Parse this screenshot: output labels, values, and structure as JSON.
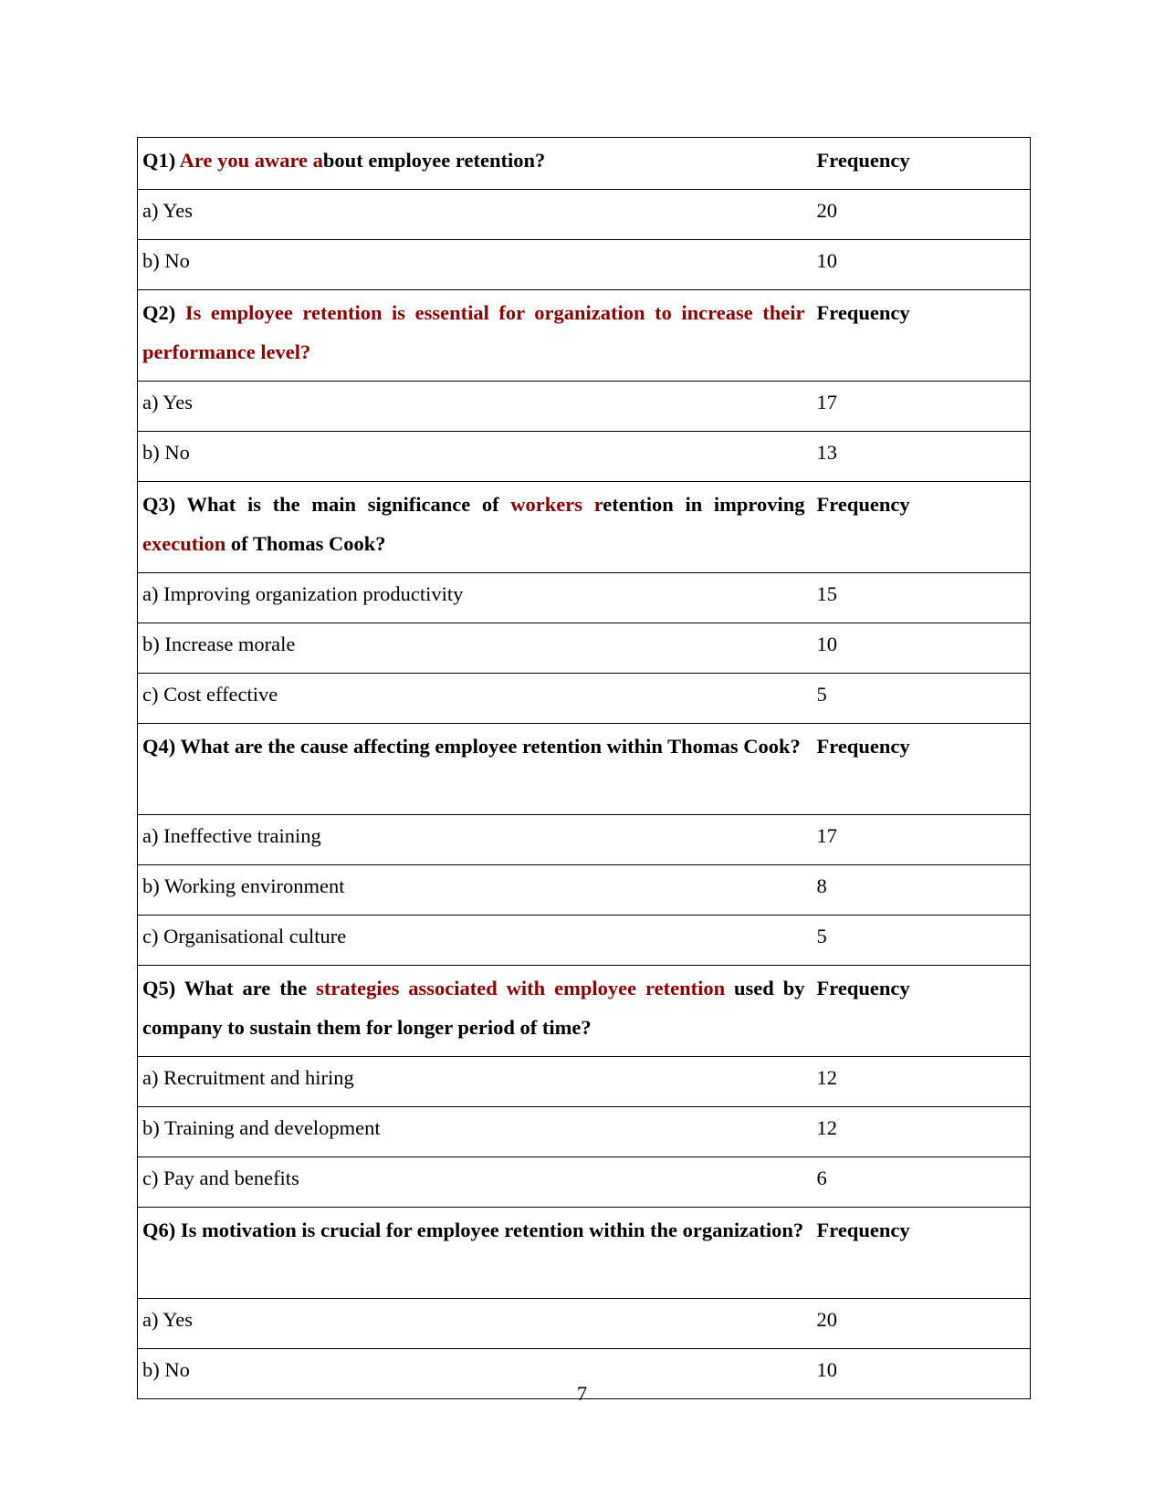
{
  "document": {
    "page_number": "7",
    "accent_color": "#8b0000",
    "frequency_header": "Frequency",
    "questions": [
      {
        "id": "Q1",
        "segments": [
          {
            "text": "Q1) ",
            "red": false
          },
          {
            "text": "Are you aware a",
            "red": true
          },
          {
            "text": "bout employee retention?",
            "red": false
          }
        ],
        "frequency_label": "Frequency",
        "options": [
          {
            "label": "a) Yes",
            "frequency": "20"
          },
          {
            "label": "b) No",
            "frequency": "10"
          }
        ]
      },
      {
        "id": "Q2",
        "segments": [
          {
            "text": "Q2) ",
            "red": false
          },
          {
            "text": "Is employee retention is essential for organization to increase their performance level?",
            "red": true
          }
        ],
        "frequency_label": "Frequency",
        "options": [
          {
            "label": "a) Yes",
            "frequency": "17"
          },
          {
            "label": "b) No",
            "frequency": "13"
          }
        ]
      },
      {
        "id": "Q3",
        "segments": [
          {
            "text": "Q3) What is the main significance of ",
            "red": false
          },
          {
            "text": "workers r",
            "red": true
          },
          {
            "text": "etention in improving ",
            "red": false
          },
          {
            "text": "execution",
            "red": true
          },
          {
            "text": " of Thomas Cook?",
            "red": false
          }
        ],
        "frequency_label": "Frequency",
        "options": [
          {
            "label": "a) Improving organization productivity",
            "frequency": "15"
          },
          {
            "label": "b) Increase morale",
            "frequency": "10"
          },
          {
            "label": "c) Cost effective",
            "frequency": "5"
          }
        ]
      },
      {
        "id": "Q4",
        "segments": [
          {
            "text": "Q4) What are the cause affecting employee retention within Thomas Cook?",
            "red": false
          }
        ],
        "frequency_label": "Frequency",
        "options": [
          {
            "label": "a) Ineffective training",
            "frequency": "17"
          },
          {
            "label": "b) Working environment",
            "frequency": "8"
          },
          {
            "label": "c) Organisational culture",
            "frequency": "5"
          }
        ]
      },
      {
        "id": "Q5",
        "segments": [
          {
            "text": "Q5) What are the ",
            "red": false
          },
          {
            "text": "strategies associated with employee retention",
            "red": true
          },
          {
            "text": " used by company to sustain  them for longer period of time?",
            "red": false
          }
        ],
        "frequency_label": "Frequency",
        "options": [
          {
            "label": "a) Recruitment and hiring",
            "frequency": "12"
          },
          {
            "label": "b) Training and development",
            "frequency": "12"
          },
          {
            "label": "c) Pay and benefits",
            "frequency": "6"
          }
        ]
      },
      {
        "id": "Q6",
        "segments": [
          {
            "text": "Q6) Is motivation is crucial for employee retention within the organization?",
            "red": false
          }
        ],
        "frequency_label": "Frequency",
        "options": [
          {
            "label": "a) Yes",
            "frequency": "20"
          },
          {
            "label": "b) No",
            "frequency": "10"
          }
        ]
      }
    ]
  }
}
